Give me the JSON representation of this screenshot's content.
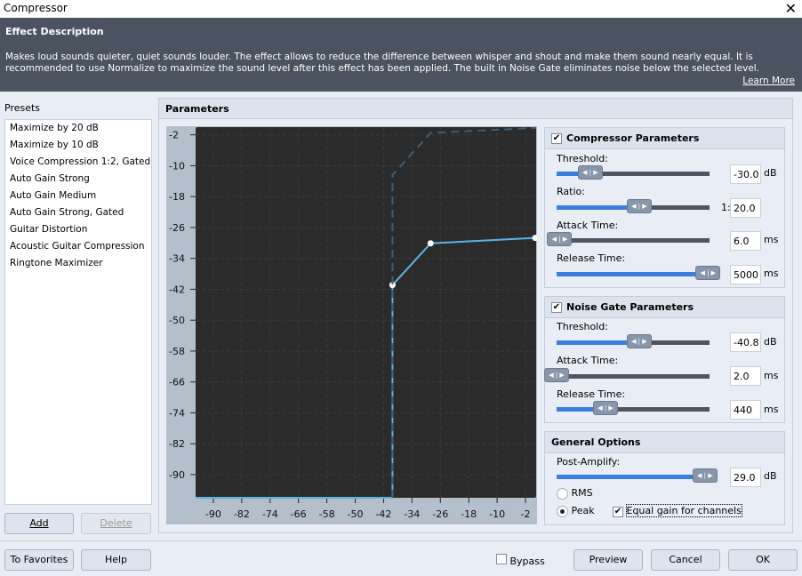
{
  "window": {
    "title": "Compressor",
    "close": "✕"
  },
  "description": {
    "heading": "Effect Description",
    "text": "Makes loud sounds quieter, quiet sounds louder. The effect allows to reduce the difference between whisper and shout and make them sound nearly equal. It is recommended to use Normalize to maximize the sound level after this effect has been applied. The built in Noise Gate eliminates noise below the selected level.",
    "learn_more": "Learn More"
  },
  "presets": {
    "label": "Presets",
    "items": [
      "Maximize by 20 dB",
      "Maximize by 10 dB",
      "Voice Compression 1:2, Gated",
      "Auto Gain Strong",
      "Auto Gain Medium",
      "Auto Gain Strong, Gated",
      "Guitar Distortion",
      "Acoustic Guitar Compression",
      "Ringtone Maximizer"
    ],
    "add": "Add",
    "delete": "Delete"
  },
  "parameters": {
    "title": "Parameters"
  },
  "chart_data": {
    "type": "line",
    "x_ticks": [
      "-90",
      "-82",
      "-74",
      "-66",
      "-58",
      "-50",
      "-42",
      "-34",
      "-26",
      "-18",
      "-10",
      "-2"
    ],
    "y_ticks": [
      "-2",
      "-10",
      "-18",
      "-26",
      "-34",
      "-42",
      "-50",
      "-58",
      "-66",
      "-74",
      "-82",
      "-90"
    ],
    "xlim": [
      -95,
      1
    ],
    "ylim": [
      -96,
      0
    ],
    "grid": true,
    "series": [
      {
        "style": "solid",
        "color": "#5ab4e6",
        "points": [
          [
            -95,
            -96
          ],
          [
            -39.5,
            -96
          ],
          [
            -39.5,
            -40.9
          ],
          [
            -28.75,
            -30.1
          ],
          [
            0.75,
            -28.7
          ]
        ],
        "markers": [
          [
            -39.5,
            -40.9
          ],
          [
            -28.75,
            -30.1
          ],
          [
            0.75,
            -28.7
          ]
        ]
      },
      {
        "style": "dashed",
        "color": "#3f5f7a",
        "points": [
          [
            -39.5,
            -96
          ],
          [
            -39.5,
            -12.4
          ],
          [
            -28.75,
            -1.5
          ],
          [
            1,
            -0.2
          ]
        ]
      }
    ]
  },
  "compressor": {
    "title": "Compressor Parameters",
    "enabled": true,
    "threshold": {
      "label": "Threshold:",
      "value": "-30.0",
      "unit": "dB",
      "level": 0.22
    },
    "ratio": {
      "label": "Ratio:",
      "prefix": "1:",
      "value": "20.0",
      "level": 0.54
    },
    "attack": {
      "label": "Attack Time:",
      "value": "6.0",
      "unit": "ms",
      "level": 0.02
    },
    "release": {
      "label": "Release Time:",
      "value": "5000",
      "unit": "ms",
      "level": 0.99
    }
  },
  "noise_gate": {
    "title": "Noise Gate Parameters",
    "enabled": true,
    "threshold": {
      "label": "Threshold:",
      "value": "-40.8",
      "unit": "dB",
      "level": 0.54
    },
    "attack": {
      "label": "Attack Time:",
      "value": "2.0",
      "unit": "ms",
      "level": 0.0
    },
    "release": {
      "label": "Release Time:",
      "value": "440",
      "unit": "ms",
      "level": 0.32
    }
  },
  "general": {
    "title": "General Options",
    "post_amplify": {
      "label": "Post-Amplify:",
      "value": "29.0",
      "unit": "dB",
      "level": 0.97
    },
    "rms": "RMS",
    "peak": "Peak",
    "mode": "Peak",
    "equal_gain": "Equal gain for channels",
    "equal_gain_checked": true
  },
  "footer": {
    "favorites": "To Favorites",
    "help": "Help",
    "bypass": "Bypass",
    "preview": "Preview",
    "cancel": "Cancel",
    "ok": "OK"
  }
}
